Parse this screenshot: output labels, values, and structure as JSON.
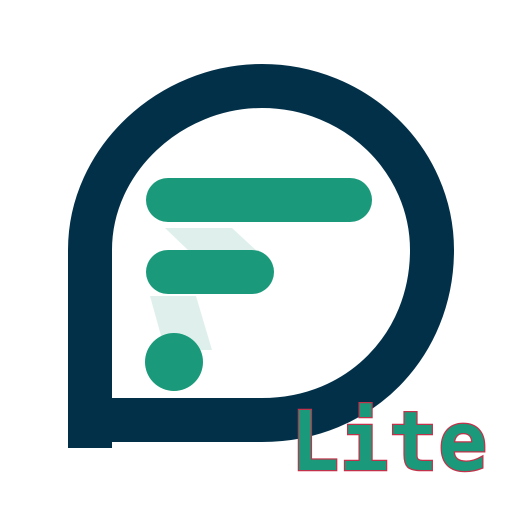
{
  "logo": {
    "badge_text": "Lite",
    "colors": {
      "ring": "#033049",
      "bars": "#1a9a7a",
      "shadow": "#dff0ec",
      "badge_fill": "#1a9a7a",
      "badge_outline": "#c2324a"
    }
  }
}
